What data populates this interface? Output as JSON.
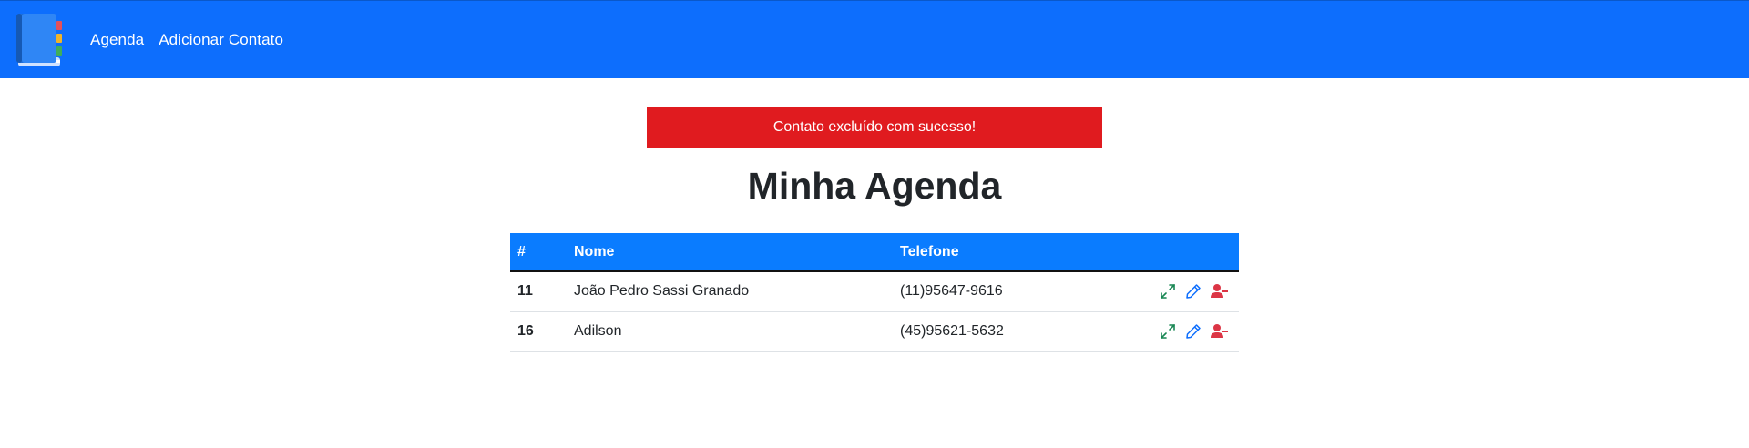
{
  "navbar": {
    "links": [
      {
        "label": "Agenda"
      },
      {
        "label": "Adicionar Contato"
      }
    ],
    "colors": {
      "background": "#0d6efd",
      "text": "#ffffff"
    }
  },
  "alert": {
    "message": "Contato excluído com sucesso!",
    "color": "#e01b1f"
  },
  "main": {
    "title": "Minha Agenda"
  },
  "table": {
    "headers": [
      "#",
      "Nome",
      "Telefone",
      ""
    ],
    "rows": [
      {
        "id": "11",
        "name": "João Pedro Sassi Granado",
        "phone": "(11)95647-9616"
      },
      {
        "id": "16",
        "name": "Adilson",
        "phone": "(45)95621-5632"
      }
    ],
    "actions": [
      {
        "icon": "expand-icon",
        "color": "#198754"
      },
      {
        "icon": "pencil-icon",
        "color": "#0d6efd"
      },
      {
        "icon": "user-minus-icon",
        "color": "#dc3545"
      }
    ],
    "header_color": "#0a7cff"
  }
}
